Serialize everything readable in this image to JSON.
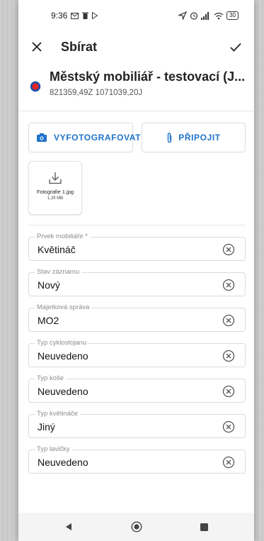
{
  "status_bar": {
    "time": "9:36",
    "battery": "30"
  },
  "app_bar": {
    "title": "Sbírat"
  },
  "layer": {
    "title": "Městský mobiliář - testovací (J...",
    "coords": "821359,49Z 1071039,20J",
    "icon_color": "#e32626",
    "icon_ring": "#1f4fa8"
  },
  "buttons": {
    "photo_label": "VYFOTOGRAFOVAT",
    "attach_label": "PŘIPOJIT"
  },
  "attachment": {
    "name": "Fotografie 1.jpg",
    "size": "1,29 MB"
  },
  "fields": [
    {
      "label": "Prvek mobiliáře *",
      "value": "Květináč"
    },
    {
      "label": "Stav záznamu",
      "value": "Nový"
    },
    {
      "label": "Majetková správa",
      "value": "MO2"
    },
    {
      "label": "Typ cyklostojanu",
      "value": "Neuvedeno"
    },
    {
      "label": "Typ koše",
      "value": "Neuvedeno"
    },
    {
      "label": "Typ květináče",
      "value": "Jiný"
    },
    {
      "label": "Typ lavičky",
      "value": "Neuvedeno"
    }
  ],
  "colors": {
    "accent": "#1f73c7"
  }
}
